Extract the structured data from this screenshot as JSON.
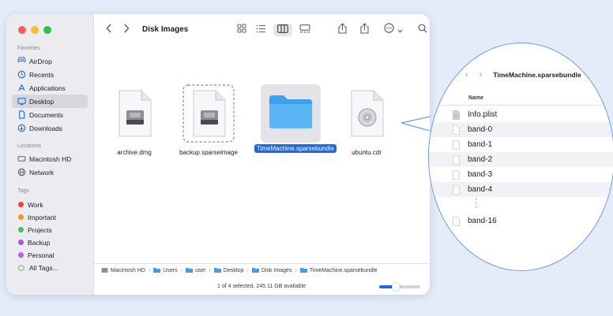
{
  "window": {
    "title": "Disk Images",
    "traffic_colors": [
      "#ff5f57",
      "#febc2e",
      "#28c840"
    ]
  },
  "sidebar": {
    "favorites_title": "Favorites",
    "favorites": [
      {
        "label": "AirDrop",
        "icon": "airdrop-icon"
      },
      {
        "label": "Recents",
        "icon": "clock-icon"
      },
      {
        "label": "Applications",
        "icon": "applications-icon"
      },
      {
        "label": "Desktop",
        "icon": "desktop-icon",
        "active": true
      },
      {
        "label": "Documents",
        "icon": "document-icon"
      },
      {
        "label": "Downloads",
        "icon": "download-icon"
      }
    ],
    "locations_title": "Locations",
    "locations": [
      {
        "label": "Macintosh HD",
        "icon": "hard-drive-icon"
      },
      {
        "label": "Network",
        "icon": "globe-icon"
      }
    ],
    "tags_title": "Tags",
    "tags": [
      {
        "label": "Work",
        "color": "#ff3b30"
      },
      {
        "label": "Important",
        "color": "#ff9500"
      },
      {
        "label": "Projects",
        "color": "#34c759"
      },
      {
        "label": "Backup",
        "color": "#af52de"
      },
      {
        "label": "Personal",
        "color": "#bf5af2"
      },
      {
        "label": "All Tags...",
        "icon": "tags-icon"
      }
    ]
  },
  "files": [
    {
      "name": "archive.dmg",
      "kind": "disk-image"
    },
    {
      "name": "backup.sparseimage",
      "kind": "disk-image-dashed"
    },
    {
      "name": "TimeMachine.sparsebundle",
      "kind": "folder",
      "selected": true
    },
    {
      "name": "ubuntu.cdr",
      "kind": "cd-image"
    }
  ],
  "pathbar": [
    "Macintosh HD",
    "Users",
    "user",
    "Desktop",
    "Disk Images",
    "TimeMachine.sparsebundle"
  ],
  "status": {
    "text": "1 of 4 selected, 245.11 GB available",
    "zoom": 0.4
  },
  "lens": {
    "title": "TimeMachine.sparsebundle",
    "column_header": "Name",
    "rows": [
      "Info.plist",
      "band-0",
      "band-1",
      "band-2",
      "band-3",
      "band-4"
    ],
    "last_row": "band-16"
  },
  "accent": "#1a69e8"
}
